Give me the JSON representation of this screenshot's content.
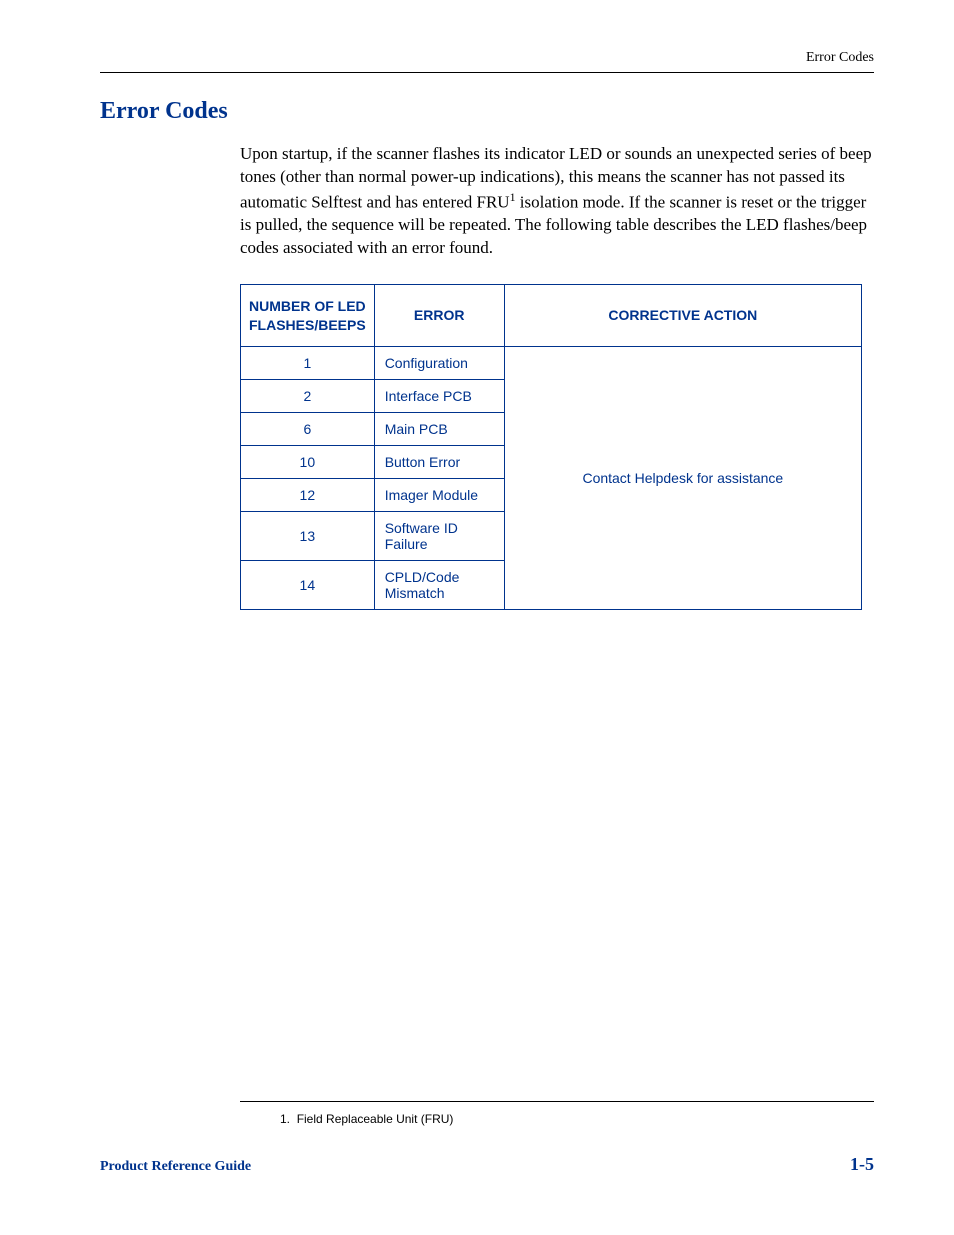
{
  "header": {
    "running_head": "Error Codes"
  },
  "section": {
    "title": "Error Codes",
    "intro_pre": "Upon startup, if the scanner flashes its indicator LED or sounds an unexpected series of beep tones (other than normal power-up indications), this means the scanner has not passed its automatic Selftest and has entered FRU",
    "intro_sup": "1",
    "intro_post": " isolation mode. If the scanner is reset or the trigger is pulled, the sequence will be repeated. The following table describes the LED flashes/beep codes associated with an error found."
  },
  "table": {
    "headers": {
      "col1": "NUMBER OF LED FLASHES/BEEPS",
      "col2": "ERROR",
      "col3": "CORRECTIVE ACTION"
    },
    "rows": [
      {
        "num": "1",
        "error": "Configuration"
      },
      {
        "num": "2",
        "error": "Interface PCB"
      },
      {
        "num": "6",
        "error": "Main PCB"
      },
      {
        "num": "10",
        "error": "Button Error"
      },
      {
        "num": "12",
        "error": "Imager Module"
      },
      {
        "num": "13",
        "error": "Software ID Failure"
      },
      {
        "num": "14",
        "error": "CPLD/Code Mismatch"
      }
    ],
    "action_text": "Contact Helpdesk for assistance"
  },
  "footnote": {
    "marker": "1.",
    "text": "Field Replaceable Unit (FRU)"
  },
  "footer": {
    "left": "Product Reference Guide",
    "right": "1-5"
  }
}
